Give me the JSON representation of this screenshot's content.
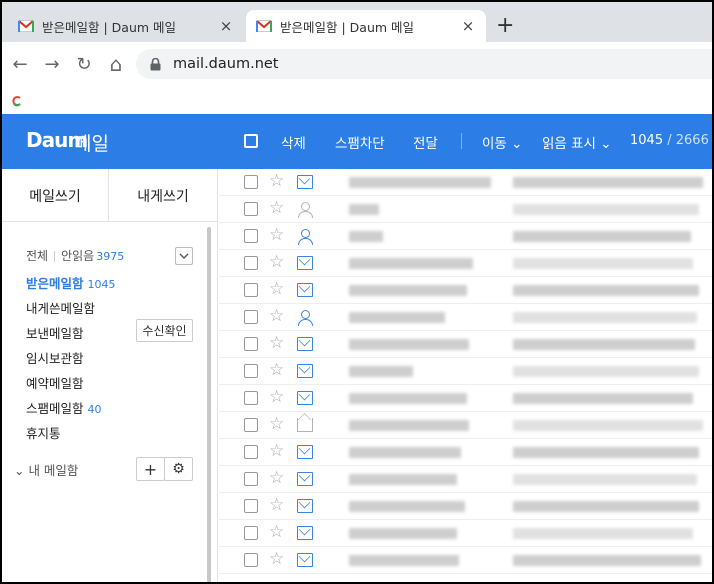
{
  "browser": {
    "tabs": [
      {
        "title": "받은메일함 | Daum 메일",
        "active": false
      },
      {
        "title": "받은메일함 | Daum 메일",
        "active": true
      }
    ],
    "close_glyph": "×",
    "new_tab_glyph": "+",
    "url": "mail.daum.net",
    "nav": {
      "back": "←",
      "forward": "→",
      "reload": "↻",
      "home": "⌂"
    }
  },
  "header": {
    "logo": "Daum",
    "product": "메일",
    "actions": {
      "delete": "삭제",
      "spam": "스팸차단",
      "forward": "전달",
      "move": "이동 ⌄",
      "read": "읽음 표시 ⌄"
    },
    "count_current": "1045",
    "count_sep": " / ",
    "count_total": "2666",
    "brand_color": "#2c7ee6"
  },
  "sidebar": {
    "compose": "메일쓰기",
    "compose_self": "내게쓰기",
    "all_label": "전체",
    "unread_label": "안읽음",
    "unread_count": "3975",
    "folders": {
      "inbox": {
        "label": "받은메일함",
        "count": "1045"
      },
      "self": {
        "label": "내게쓴메일함"
      },
      "sent": {
        "label": "보낸메일함"
      },
      "drafts": {
        "label": "임시보관함"
      },
      "scheduled": {
        "label": "예약메일함"
      },
      "spam": {
        "label": "스팸메일함",
        "count": "40"
      },
      "trash": {
        "label": "휴지통"
      }
    },
    "receipt_button": "수신확인",
    "my_mailbox": "⌄ 내 메일함",
    "add_glyph": "+",
    "settings_glyph": "⚙"
  },
  "mail_list": {
    "rows": [
      {
        "icon": "envelope-icon"
      },
      {
        "icon": "person-icon-grey"
      },
      {
        "icon": "person-icon-blue"
      },
      {
        "icon": "envelope-icon"
      },
      {
        "icon": "envelope-icon"
      },
      {
        "icon": "person-icon-blue"
      },
      {
        "icon": "envelope-icon"
      },
      {
        "icon": "envelope-icon"
      },
      {
        "icon": "envelope-icon"
      },
      {
        "icon": "envelope-open-icon"
      },
      {
        "icon": "envelope-icon"
      },
      {
        "icon": "envelope-icon"
      },
      {
        "icon": "envelope-icon"
      },
      {
        "icon": "envelope-icon"
      },
      {
        "icon": "envelope-icon"
      }
    ]
  }
}
